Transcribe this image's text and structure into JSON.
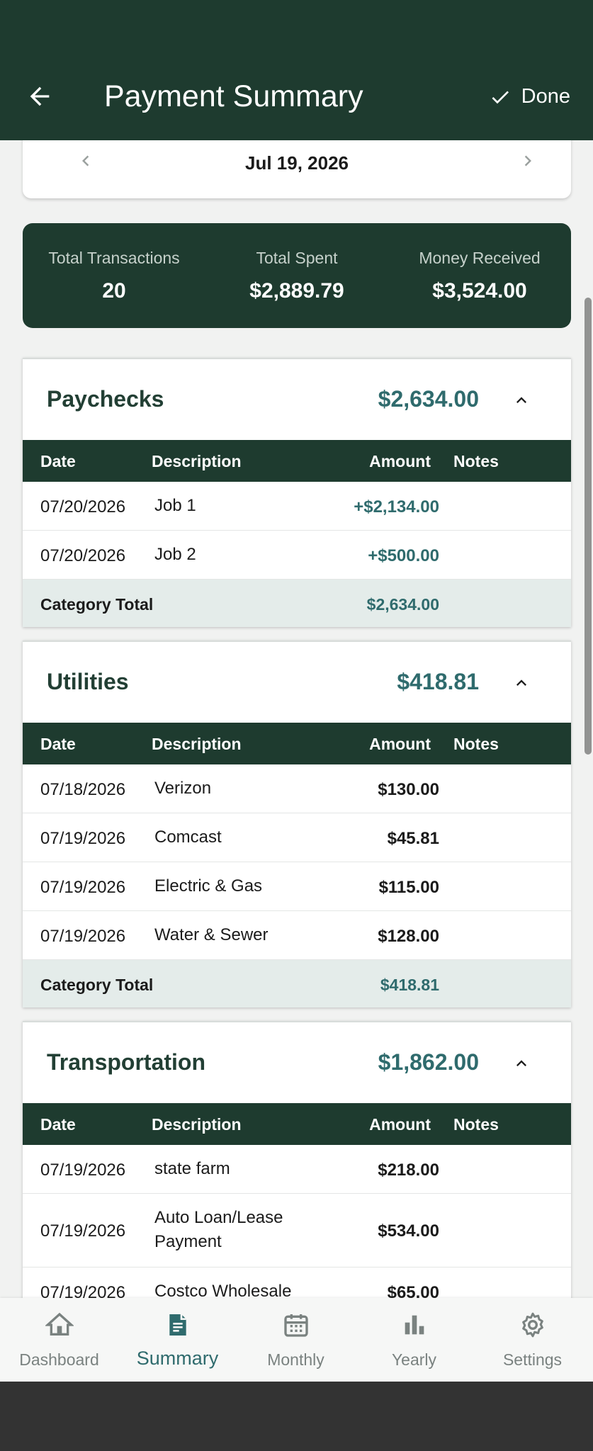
{
  "header": {
    "title": "Payment Summary",
    "done_label": "Done"
  },
  "date_nav": {
    "date": "Jul 19, 2026"
  },
  "stats": [
    {
      "label": "Total Transactions",
      "value": "20"
    },
    {
      "label": "Total Spent",
      "value": "$2,889.79"
    },
    {
      "label": "Money Received",
      "value": "$3,524.00"
    }
  ],
  "table_headers": {
    "date": "Date",
    "description": "Description",
    "amount": "Amount",
    "notes": "Notes"
  },
  "total_label": "Category Total",
  "categories": [
    {
      "name": "Paychecks",
      "total": "$2,634.00",
      "rows": [
        {
          "date": "07/20/2026",
          "description": "Job 1",
          "amount": "+$2,134.00"
        },
        {
          "date": "07/20/2026",
          "description": "Job 2",
          "amount": "+$500.00"
        }
      ],
      "category_total": "$2,634.00"
    },
    {
      "name": "Utilities",
      "total": "$418.81",
      "rows": [
        {
          "date": "07/18/2026",
          "description": "Verizon",
          "amount": "$130.00"
        },
        {
          "date": "07/19/2026",
          "description": "Comcast",
          "amount": "$45.81"
        },
        {
          "date": "07/19/2026",
          "description": "Electric & Gas",
          "amount": "$115.00"
        },
        {
          "date": "07/19/2026",
          "description": "Water & Sewer",
          "amount": "$128.00"
        }
      ],
      "category_total": "$418.81"
    },
    {
      "name": "Transportation",
      "total": "$1,862.00",
      "rows": [
        {
          "date": "07/19/2026",
          "description": "state farm",
          "amount": "$218.00"
        },
        {
          "date": "07/19/2026",
          "description": "Auto Loan/Lease Payment",
          "amount": "$534.00"
        },
        {
          "date": "07/19/2026",
          "description": "Costco Wholesale",
          "amount": "$65.00"
        }
      ]
    }
  ],
  "bottom_nav": [
    {
      "label": "Dashboard",
      "icon": "home-icon",
      "active": false
    },
    {
      "label": "Summary",
      "icon": "summary-icon",
      "active": true
    },
    {
      "label": "Monthly",
      "icon": "calendar-icon",
      "active": false
    },
    {
      "label": "Yearly",
      "icon": "bar-chart-icon",
      "active": false
    },
    {
      "label": "Settings",
      "icon": "gear-icon",
      "active": false
    }
  ],
  "colors": {
    "primary": "#1e3b2f",
    "accent": "#2f6b6d",
    "total_row_bg": "#e4ecea"
  }
}
